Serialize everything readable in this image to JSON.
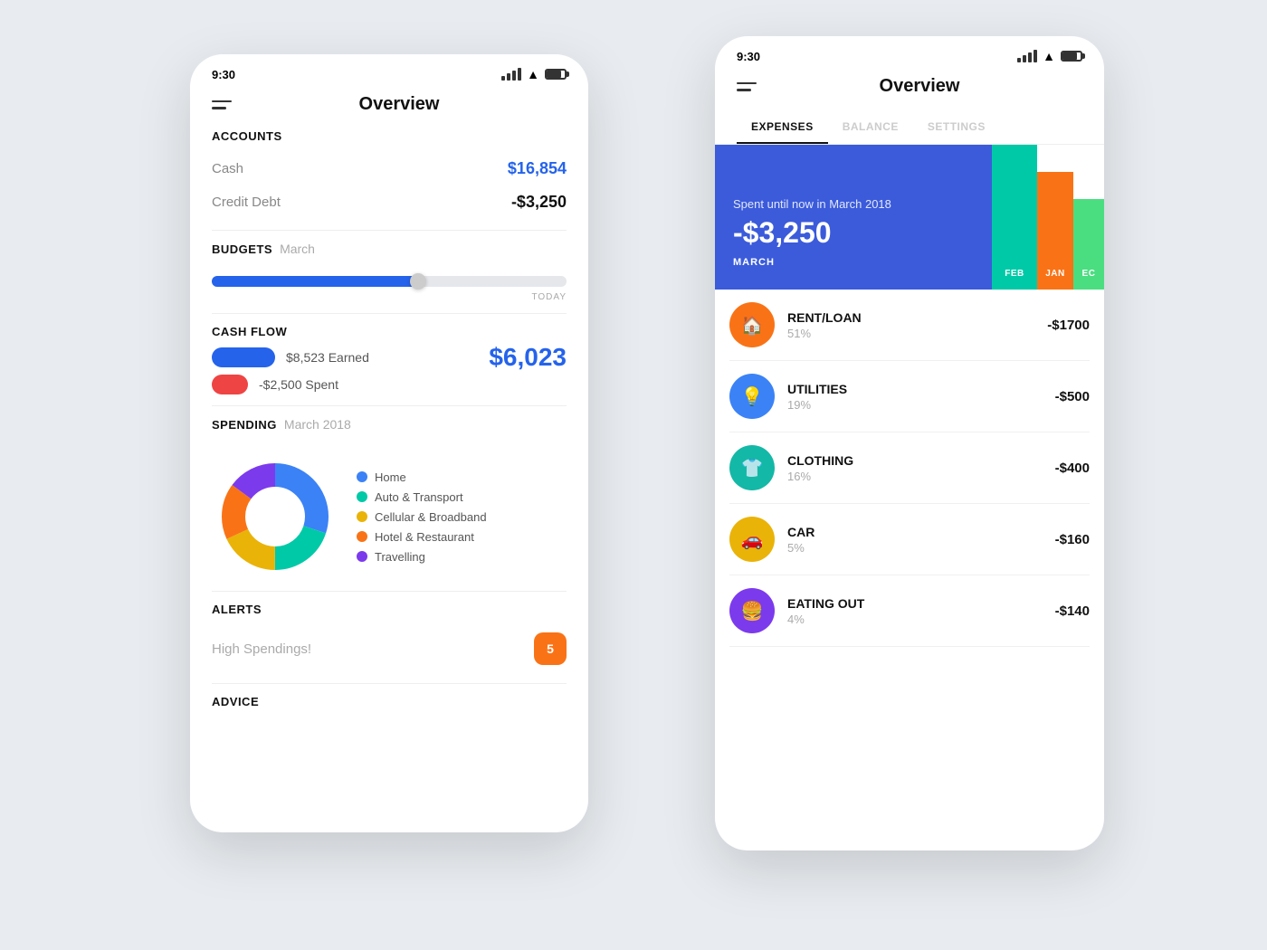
{
  "phone1": {
    "status_time": "9:30",
    "nav_title": "Overview",
    "accounts_label": "ACCOUNTS",
    "cash_label": "Cash",
    "cash_value": "$16,854",
    "credit_label": "Credit Debt",
    "credit_value": "-$3,250",
    "budgets_label": "BUDGETS",
    "budgets_month": "March",
    "today_label": "TODAY",
    "cashflow_label": "CASH FLOW",
    "earned_label": "$8,523 Earned",
    "spent_label": "-$2,500 Spent",
    "cashflow_total": "$6,023",
    "spending_label": "SPENDING",
    "spending_month": "March 2018",
    "legend": [
      {
        "color": "#3b82f6",
        "label": "Home"
      },
      {
        "color": "#00c9a7",
        "label": "Auto & Transport"
      },
      {
        "color": "#eab308",
        "label": "Cellular & Broadband"
      },
      {
        "color": "#f97316",
        "label": "Hotel & Restaurant"
      },
      {
        "color": "#7c3aed",
        "label": "Travelling"
      }
    ],
    "alerts_label": "ALERTS",
    "alerts_text": "High Spendings!",
    "alerts_badge": "5",
    "advice_label": "ADVICE"
  },
  "phone2": {
    "status_time": "9:30",
    "nav_title": "Overview",
    "tabs": [
      {
        "label": "EXPENSES",
        "active": true
      },
      {
        "label": "BALANCE",
        "active": false
      },
      {
        "label": "SETTINGS",
        "active": false
      }
    ],
    "hero": {
      "subtitle": "Spent until now in March 2018",
      "amount": "-$3,250",
      "month_label": "MARCH",
      "months": [
        {
          "label": "FEB",
          "color": "#00c9a7"
        },
        {
          "label": "JAN",
          "color": "#f97316"
        },
        {
          "label": "EC",
          "color": "#4ade80"
        }
      ]
    },
    "expenses": [
      {
        "icon": "🏠",
        "icon_bg": "orange",
        "name": "RENT/LOAN",
        "pct": "51%",
        "amount": "-$1700"
      },
      {
        "icon": "💡",
        "icon_bg": "blue",
        "name": "UTILITIES",
        "pct": "19%",
        "amount": "-$500"
      },
      {
        "icon": "👕",
        "icon_bg": "teal",
        "name": "CLOTHING",
        "pct": "16%",
        "amount": "-$400"
      },
      {
        "icon": "🚗",
        "icon_bg": "yellow",
        "name": "CAR",
        "pct": "5%",
        "amount": "-$160"
      },
      {
        "icon": "🍔",
        "icon_bg": "purple",
        "name": "EATING OUT",
        "pct": "4%",
        "amount": "-$140"
      }
    ]
  },
  "donut": {
    "segments": [
      {
        "color": "#3b82f6",
        "value": 30
      },
      {
        "color": "#00c9a7",
        "value": 20
      },
      {
        "color": "#eab308",
        "value": 18
      },
      {
        "color": "#f97316",
        "value": 17
      },
      {
        "color": "#7c3aed",
        "value": 15
      }
    ]
  }
}
